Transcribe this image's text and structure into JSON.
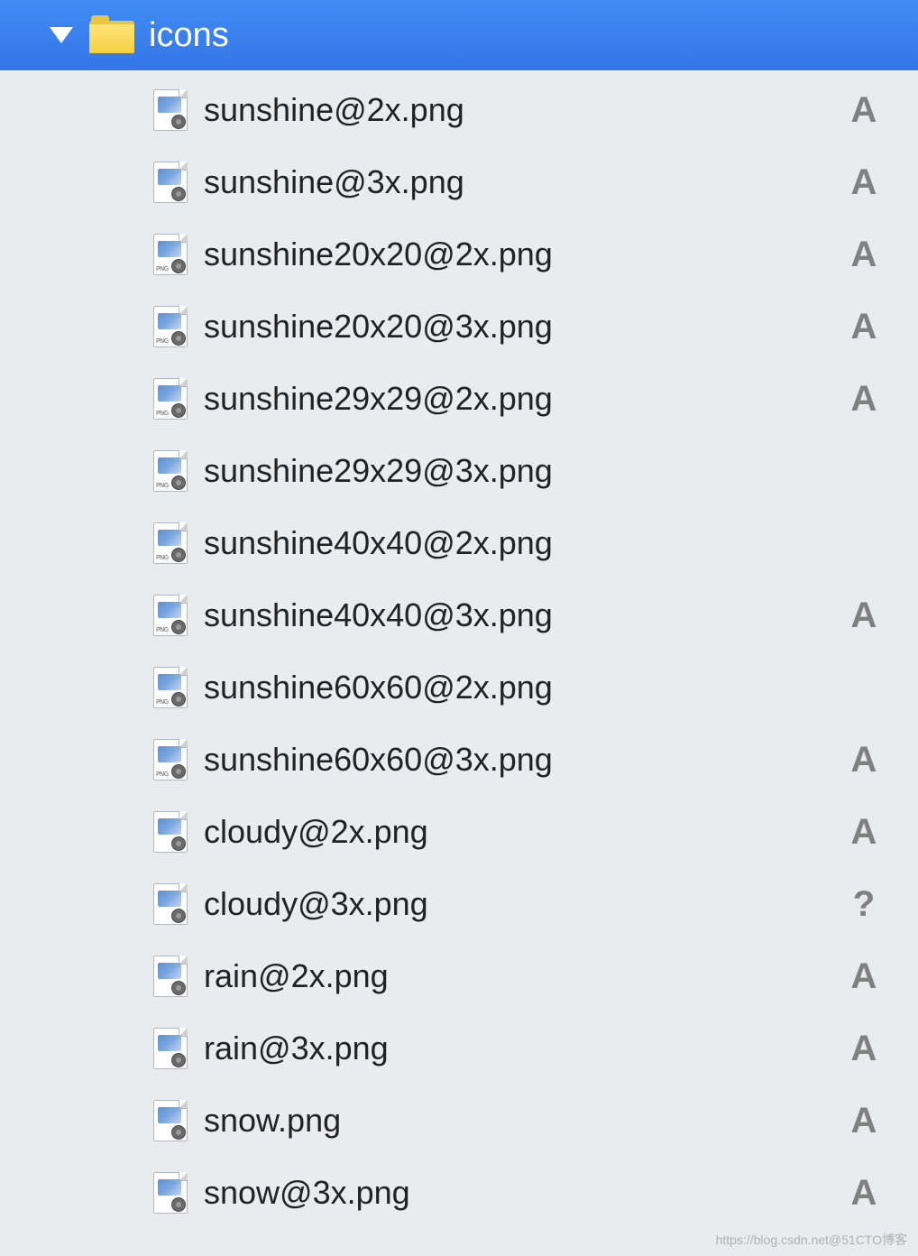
{
  "folder": {
    "name": "icons"
  },
  "files": [
    {
      "name": "sunshine@2x.png",
      "status": "A",
      "show_png_label": false
    },
    {
      "name": "sunshine@3x.png",
      "status": "A",
      "show_png_label": false
    },
    {
      "name": "sunshine20x20@2x.png",
      "status": "A",
      "show_png_label": true
    },
    {
      "name": "sunshine20x20@3x.png",
      "status": "A",
      "show_png_label": true
    },
    {
      "name": "sunshine29x29@2x.png",
      "status": "A",
      "show_png_label": true
    },
    {
      "name": "sunshine29x29@3x.png",
      "status": "",
      "show_png_label": true
    },
    {
      "name": "sunshine40x40@2x.png",
      "status": "",
      "show_png_label": true
    },
    {
      "name": "sunshine40x40@3x.png",
      "status": "A",
      "show_png_label": true
    },
    {
      "name": "sunshine60x60@2x.png",
      "status": "",
      "show_png_label": true
    },
    {
      "name": "sunshine60x60@3x.png",
      "status": "A",
      "show_png_label": true
    },
    {
      "name": "cloudy@2x.png",
      "status": "A",
      "show_png_label": false
    },
    {
      "name": "cloudy@3x.png",
      "status": "?",
      "show_png_label": false
    },
    {
      "name": "rain@2x.png",
      "status": "A",
      "show_png_label": false
    },
    {
      "name": "rain@3x.png",
      "status": "A",
      "show_png_label": false
    },
    {
      "name": "snow.png",
      "status": "A",
      "show_png_label": false
    },
    {
      "name": "snow@3x.png",
      "status": "A",
      "show_png_label": false
    }
  ],
  "png_label_text": "PNG",
  "watermark": "https://blog.csdn.net@51CTO博客"
}
